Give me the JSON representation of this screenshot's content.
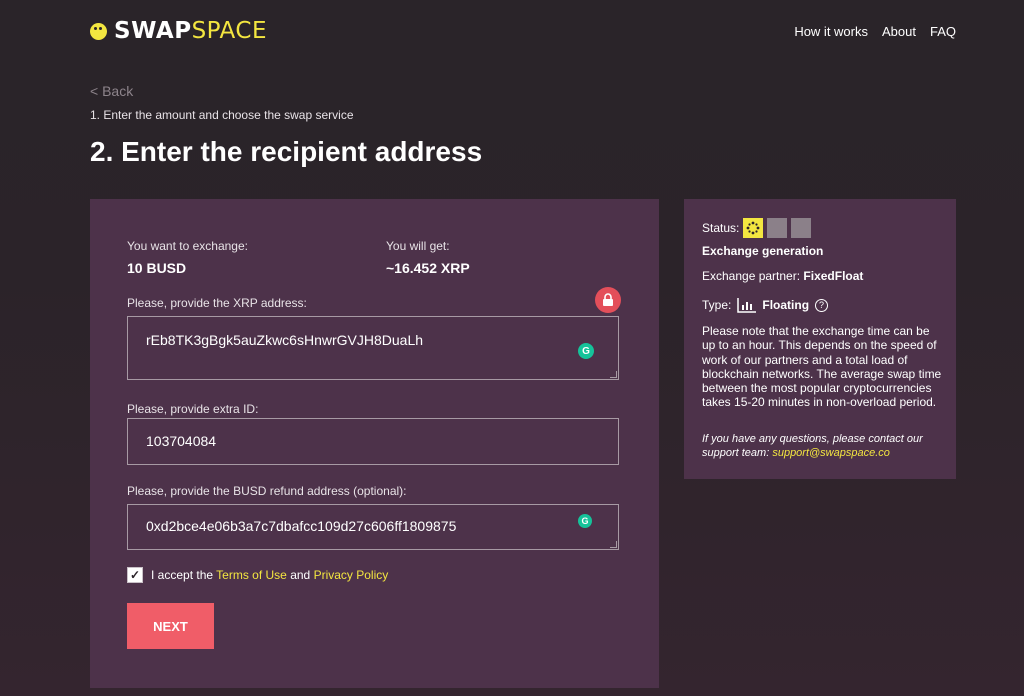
{
  "header": {
    "logo_swap": "SWAP",
    "logo_space": "SPACE",
    "nav": [
      "How it works",
      "About",
      "FAQ"
    ]
  },
  "breadcrumb": {
    "back": "< Back",
    "step1": "1. Enter the amount and choose the swap service"
  },
  "page_title": "2. Enter the recipient address",
  "form": {
    "exchange_label": "You want to exchange:",
    "exchange_value": "10 BUSD",
    "get_label": "You will get:",
    "get_value": "~16.452 XRP",
    "xrp_address_label": "Please, provide the XRP address:",
    "xrp_address_value": "rEb8TK3gBgk5auZkwc6sHnwrGVJH8DuaLh",
    "extra_id_label": "Please, provide extra ID:",
    "extra_id_value": "103704084",
    "refund_label": "Please, provide the BUSD refund address (optional):",
    "refund_value": "0xd2bce4e06b3a7c7dbafcc109d27c606ff1809875",
    "accept_prefix": "I accept the",
    "terms_link": "Terms of Use",
    "accept_and": "and",
    "privacy_link": "Privacy Policy",
    "next_button": "NEXT",
    "accepted": true
  },
  "status_panel": {
    "status_label": "Status:",
    "status_text": "Exchange generation",
    "partner_label": "Exchange partner:",
    "partner_value": "FixedFloat",
    "type_label": "Type:",
    "type_value": "Floating",
    "note": "Please note that the exchange time can be up to an hour. This depends on the speed of work of our partners and a total load of blockchain networks. The average swap time between the most popular cryptocurrencies takes 15-20 minutes in non-overload period.",
    "contact_text": "If you have any questions, please contact our support team:",
    "support_email": "support@swapspace.co"
  },
  "colors": {
    "accent": "#f3e640",
    "button": "#f05d68",
    "card_bg": "#4d324a",
    "page_bg": "#2a2429"
  },
  "icons": [
    "logo-mark-icon",
    "lock-icon",
    "grammarly-icon",
    "status-step-icon",
    "floating-chart-icon",
    "help-icon",
    "checkmark-icon"
  ]
}
